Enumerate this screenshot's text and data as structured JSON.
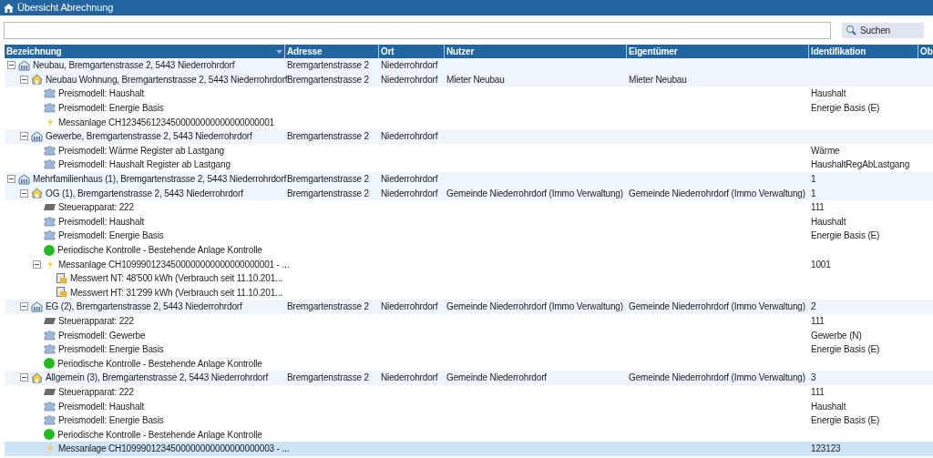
{
  "window": {
    "title": "Übersicht Abrechnung"
  },
  "search": {
    "button": "Suchen"
  },
  "table": {
    "columns": [
      "Bezeichnung",
      "Adresse",
      "Ort",
      "Nutzer",
      "Eigentümer",
      "Identifikation",
      "Ob"
    ],
    "rows": [
      {
        "kind": "building",
        "label": "Neubau, Bremgartenstrasse 2, 5443 Niederrohrdorf",
        "expanded": true,
        "selected": false,
        "adresse": "Bremgartenstrasse 2",
        "ort": "Niederrohrdorf",
        "children": [
          {
            "kind": "unit",
            "label": "Neubau Wohnung, Bremgartenstrasse 2, 5443 Niederrohrdorf",
            "expanded": true,
            "selected": false,
            "adresse": "Bremgartenstrasse 2",
            "ort": "Niederrohrdorf",
            "nutzer": "Mieter Neubau",
            "eigentuemer": "Mieter Neubau",
            "children": [
              {
                "kind": "price",
                "label": "Preismodell: Haushalt",
                "selected": false,
                "identifikation": "Haushalt"
              },
              {
                "kind": "price",
                "label": "Preismodell: Energie Basis",
                "selected": false,
                "identifikation": "Energie Basis (E)"
              },
              {
                "kind": "meter",
                "label": "Messanlage CH1234561234500000000000000000001",
                "selected": false
              }
            ]
          },
          {
            "kind": "building",
            "label": "Gewerbe, Bremgartenstrasse 2, 5443 Niederrohrdorf",
            "expanded": true,
            "selected": false,
            "adresse": "Bremgartenstrasse 2",
            "ort": "Niederrohrdorf",
            "children": [
              {
                "kind": "price",
                "label": "Preismodell: Wärme Register ab Lastgang",
                "selected": false,
                "identifikation": "Wärme"
              },
              {
                "kind": "price",
                "label": "Preismodell: Haushalt Register ab Lastgang",
                "selected": false,
                "identifikation": "HaushaltRegAbLastgang"
              }
            ]
          }
        ]
      },
      {
        "kind": "building",
        "label": "Mehrfamilienhaus (1), Bremgartenstrasse 2, 5443 Niederrohrdorf",
        "expanded": true,
        "selected": false,
        "adresse": "Bremgartenstrasse 2",
        "ort": "Niederrohrdorf",
        "identifikation": "1",
        "children": [
          {
            "kind": "unit",
            "label": "OG (1), Bremgartenstrasse 2, 5443 Niederrohrdorf",
            "expanded": true,
            "selected": false,
            "adresse": "Bremgartenstrasse 2",
            "ort": "Niederrohrdorf",
            "nutzer": "Gemeinde Niederrohrdorf (Immo Verwaltung)",
            "eigentuemer": "Gemeinde Niederrohrdorf (Immo Verwaltung)",
            "identifikation": "1",
            "children": [
              {
                "kind": "device",
                "label": "Steuerapparat: 222",
                "selected": false,
                "identifikation": "111"
              },
              {
                "kind": "price",
                "label": "Preismodell: Haushalt",
                "selected": false,
                "identifikation": "Haushalt"
              },
              {
                "kind": "price",
                "label": "Preismodell: Energie Basis",
                "selected": false,
                "identifikation": "Energie Basis (E)"
              },
              {
                "kind": "control",
                "label": "Periodische Kontrolle - Bestehende Anlage Kontrolle",
                "color": "#22bb22",
                "selected": false
              },
              {
                "kind": "meter",
                "label": "Messanlage CH1099901234500000000000000000001 - ...",
                "expanded": true,
                "selected": false,
                "identifikation": "1001",
                "children": [
                  {
                    "kind": "reading",
                    "label": "Messwert NT: 48'500 kWh (Verbrauch seit 11.10.201...",
                    "selected": false
                  },
                  {
                    "kind": "reading",
                    "label": "Messwert HT: 31'299 kWh (Verbrauch seit 11.10.201...",
                    "selected": false
                  }
                ]
              }
            ]
          },
          {
            "kind": "building",
            "label": "EG (2), Bremgartenstrasse 2, 5443 Niederrohrdorf",
            "expanded": true,
            "selected": false,
            "adresse": "Bremgartenstrasse 2",
            "ort": "Niederrohrdorf",
            "nutzer": "Gemeinde Niederrohrdorf (Immo Verwaltung)",
            "eigentuemer": "Gemeinde Niederrohrdorf (Immo Verwaltung)",
            "identifikation": "2",
            "children": [
              {
                "kind": "device",
                "label": "Steuerapparat: 222",
                "selected": false,
                "identifikation": "111"
              },
              {
                "kind": "price",
                "label": "Preismodell: Gewerbe",
                "selected": false,
                "identifikation": "Gewerbe (N)"
              },
              {
                "kind": "price",
                "label": "Preismodell: Energie Basis",
                "selected": false,
                "identifikation": "Energie Basis (E)"
              },
              {
                "kind": "control",
                "label": "Periodische Kontrolle - Bestehende Anlage Kontrolle",
                "color": "#22bb22",
                "selected": false
              }
            ]
          },
          {
            "kind": "unit",
            "label": "Allgemein (3), Bremgartenstrasse 2, 5443 Niederrohrdorf",
            "expanded": true,
            "selected": false,
            "adresse": "Bremgartenstrasse 2",
            "ort": "Niederrohrdorf",
            "nutzer": "Gemeinde Niederrohrdorf",
            "eigentuemer": "Gemeinde Niederrohrdorf (Immo Verwaltung)",
            "identifikation": "3",
            "children": [
              {
                "kind": "device",
                "label": "Steuerapparat: 222",
                "selected": false,
                "identifikation": "111"
              },
              {
                "kind": "price",
                "label": "Preismodell: Haushalt",
                "selected": false,
                "identifikation": "Haushalt"
              },
              {
                "kind": "price",
                "label": "Preismodell: Energie Basis",
                "selected": false,
                "identifikation": "Energie Basis (E)"
              },
              {
                "kind": "control",
                "label": "Periodische Kontrolle - Bestehende Anlage Kontrolle",
                "color": "#22bb22",
                "selected": false
              },
              {
                "kind": "meter",
                "label": "Messanlage CH1099901234500000000000000000003 - ...",
                "selected": true,
                "identifikation": "123123"
              }
            ]
          }
        ]
      }
    ]
  }
}
